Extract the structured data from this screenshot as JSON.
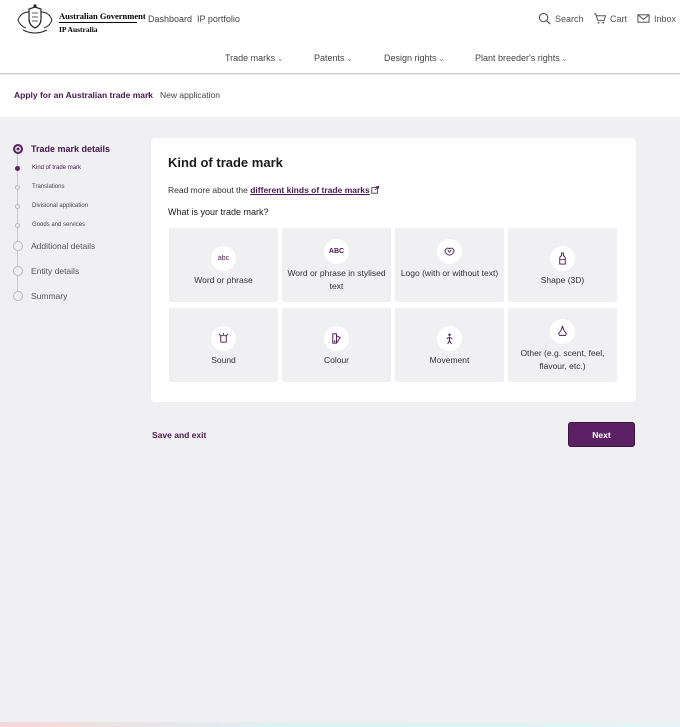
{
  "header": {
    "gov_line1": "Australian Government",
    "gov_line2": "IP Australia",
    "links": [
      "Dashboard",
      "IP portfolio"
    ],
    "search_label": "Search",
    "cart_label": "Cart",
    "inbox_label": "Inbox"
  },
  "nav": {
    "items": [
      "Trade marks",
      "Patents",
      "Design rights",
      "Plant breeder's rights"
    ]
  },
  "breadcrumb": {
    "link": "Apply for an Australian trade mark",
    "current": "New application"
  },
  "steps": {
    "trade_mark_details": "Trade mark details",
    "subs": [
      "Kind of trade mark",
      "Translations",
      "Divisional application",
      "Goods and services"
    ],
    "additional": "Additional details",
    "entity": "Entity details",
    "summary": "Summary"
  },
  "card": {
    "title": "Kind of trade mark",
    "read_more_prefix": "Read more about the ",
    "read_more_link": "different kinds of trade marks",
    "question": "What is your trade mark?",
    "options": [
      {
        "label": "Word or phrase",
        "icon": "abc-icon",
        "icon_text": "abc"
      },
      {
        "label": "Word or phrase in stylised text",
        "icon": "stylised-abc-icon",
        "icon_text": "ABC"
      },
      {
        "label": "Logo (with or without text)",
        "icon": "logo-icon"
      },
      {
        "label": "Shape (3D)",
        "icon": "bottle-icon"
      },
      {
        "label": "Sound",
        "icon": "sound-icon"
      },
      {
        "label": "Colour",
        "icon": "palette-icon"
      },
      {
        "label": "Movement",
        "icon": "movement-icon"
      },
      {
        "label": "Other (e.g. scent, feel, flavour, etc.)",
        "icon": "nose-icon"
      }
    ]
  },
  "actions": {
    "save_exit": "Save and exit",
    "next": "Next"
  },
  "colors": {
    "brand": "#5c2165",
    "link": "#4a1650",
    "page_bg": "#f0eff2"
  }
}
